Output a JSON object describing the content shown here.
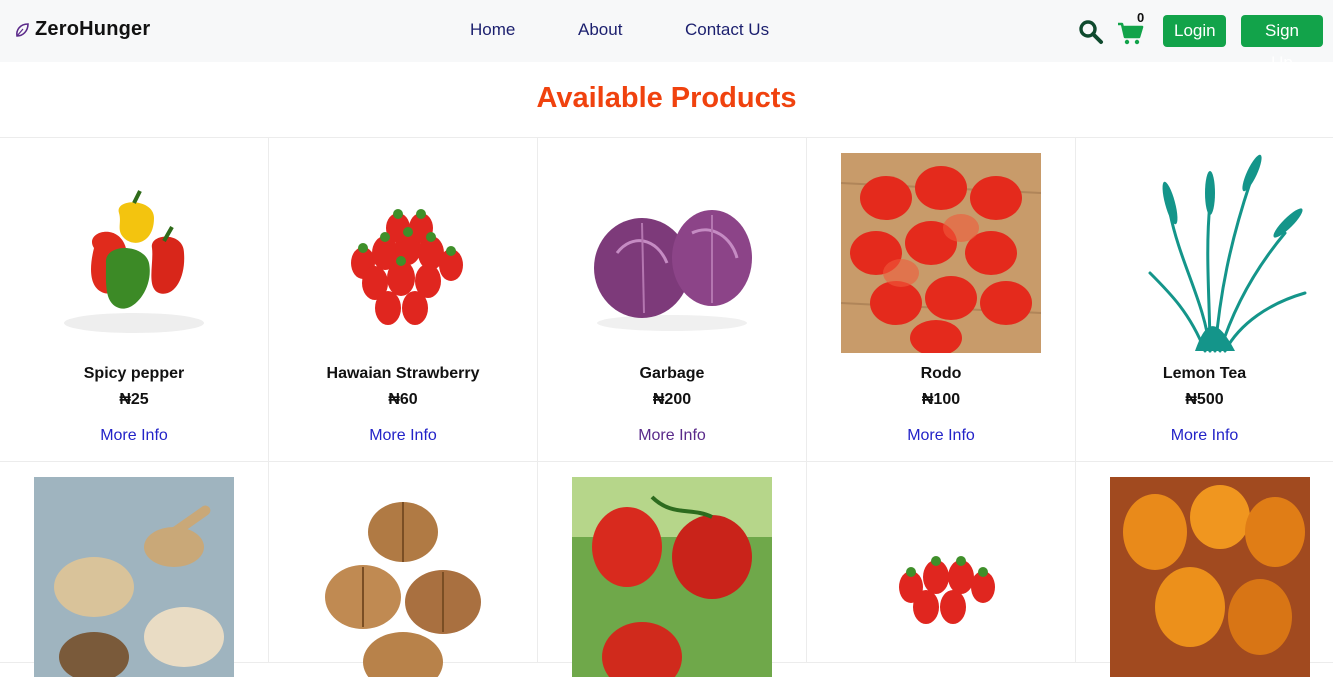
{
  "brand": {
    "name": "ZeroHunger"
  },
  "nav": {
    "links": [
      {
        "label": "Home"
      },
      {
        "label": "About"
      },
      {
        "label": "Contact Us"
      }
    ],
    "cart_count": "0",
    "login_label": "Login",
    "signup_label": "Sign Up"
  },
  "colors": {
    "accent": "#12a34a",
    "title": "#f0420e",
    "link": "#2323c8",
    "nav_bg": "#f7f8f9"
  },
  "page": {
    "title": "Available Products"
  },
  "products": [
    {
      "name": "Spicy pepper",
      "price": "₦25",
      "more": "More Info",
      "icon": "bell-peppers-image"
    },
    {
      "name": "Hawaian Strawberry",
      "price": "₦60",
      "more": "More Info",
      "icon": "strawberries-image"
    },
    {
      "name": "Garbage",
      "price": "₦200",
      "more": "More Info",
      "icon": "purple-cabbage-image"
    },
    {
      "name": "Rodo",
      "price": "₦100",
      "more": "More Info",
      "icon": "red-habanero-image"
    },
    {
      "name": "Lemon Tea",
      "price": "₦500",
      "more": "More Info",
      "icon": "lemongrass-image"
    }
  ],
  "products_row2": [
    {
      "icon": "grains-image"
    },
    {
      "icon": "walnuts-image"
    },
    {
      "icon": "tomatoes-image"
    },
    {
      "icon": "strawberries-image"
    },
    {
      "icon": "orange-fruits-image"
    }
  ]
}
